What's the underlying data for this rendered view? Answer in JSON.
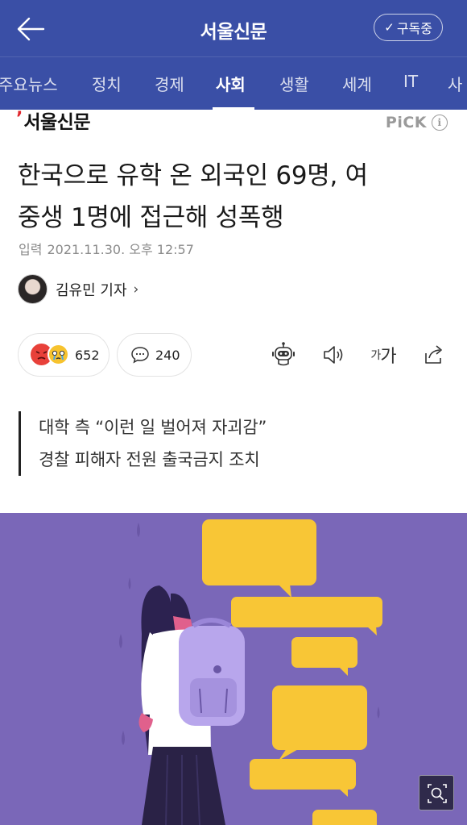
{
  "header": {
    "title": "서울신문",
    "subscribe_label": "구독중",
    "subscribe_check": "✓"
  },
  "categories": [
    {
      "label": "주요뉴스",
      "active": false
    },
    {
      "label": "정치",
      "active": false
    },
    {
      "label": "경제",
      "active": false
    },
    {
      "label": "사회",
      "active": true
    },
    {
      "label": "생활",
      "active": false
    },
    {
      "label": "세계",
      "active": false
    },
    {
      "label": "IT",
      "active": false
    },
    {
      "label": "사",
      "active": false
    }
  ],
  "article": {
    "press_name": "서울신문",
    "pick_label": "PiCK",
    "info_glyph": "i",
    "headline_line1": "한국으로 유학 온 외국인 69명, 여",
    "headline_line2": "중생 1명에 접근해 성폭행",
    "date_label": "입력",
    "date_value": "2021.11.30. 오후 12:57",
    "author_name": "김유민 기자",
    "author_chevron": "›",
    "reaction_count": "652",
    "comment_count": "240",
    "font_size_small": "가",
    "font_size_large": "가",
    "summary_line1": "대학 측 “이런 일 벌어져 자괴감”",
    "summary_line2": "경찰 피해자 전원 출국금지 조치"
  },
  "colors": {
    "header_bg": "#3a4fa6",
    "illustration_bg": "#7a67b8",
    "speech_bubble": "#f8c636",
    "press_accent": "#e0262c"
  },
  "icons": [
    "back-arrow-icon",
    "check-icon",
    "info-icon",
    "angry-emoji-icon",
    "crying-emoji-icon",
    "comment-bubble-icon",
    "robot-icon",
    "speaker-icon",
    "share-icon",
    "zoom-search-icon"
  ]
}
